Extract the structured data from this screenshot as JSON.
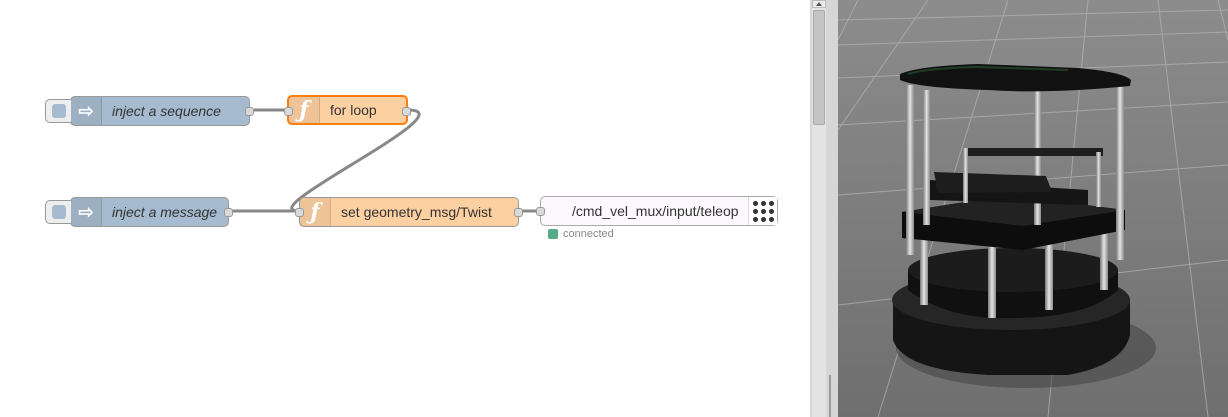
{
  "flow": {
    "nodes": [
      {
        "id": "inject-sequence",
        "type": "inject",
        "label": "inject a sequence"
      },
      {
        "id": "for-loop",
        "type": "function",
        "label": "for loop"
      },
      {
        "id": "inject-message",
        "type": "inject",
        "label": "inject a message"
      },
      {
        "id": "set-twist",
        "type": "function",
        "label": "set geometry_msg/Twist"
      },
      {
        "id": "ros-publish",
        "type": "ros",
        "label": "/cmd_vel_mux/input/teleop"
      }
    ],
    "status": {
      "text": "connected",
      "color": "#55aa88"
    }
  },
  "icons": {
    "inject": "arrow-right-icon",
    "function": "function-f-icon",
    "ros": "dot-grid-icon"
  },
  "colors": {
    "inject": "#a6bbcf",
    "function": "#fdd0a2",
    "selected_border": "#ff7f0e",
    "wire": "#888888"
  },
  "simulator": {
    "subject": "TurtleBot robot in 3D simulator"
  }
}
